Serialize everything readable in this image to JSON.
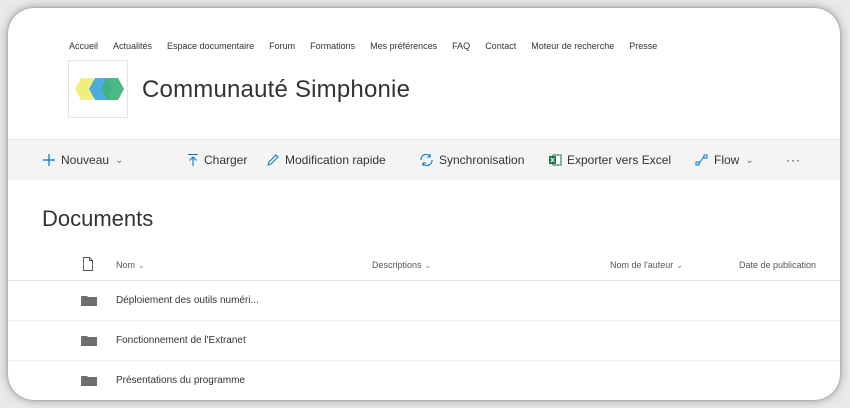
{
  "topnav": {
    "items": [
      "Accueil",
      "Actualités",
      "Espace documentaire",
      "Forum",
      "Formations",
      "Mes préférences",
      "FAQ",
      "Contact",
      "Moteur de recherche",
      "Presse"
    ]
  },
  "site": {
    "title": "Communauté Simphonie"
  },
  "commandbar": {
    "new_label": "Nouveau",
    "upload_label": "Charger",
    "quick_edit_label": "Modification rapide",
    "sync_label": "Synchronisation",
    "export_label": "Exporter vers Excel",
    "flow_label": "Flow",
    "more_label": "···"
  },
  "library": {
    "title": "Documents",
    "columns": {
      "name": "Nom",
      "descriptions": "Descriptions",
      "author": "Nom de l'auteur",
      "published": "Date de publication"
    },
    "rows": [
      {
        "name": "Déploiement des outils numéri..."
      },
      {
        "name": "Fonctionnement de l'Extranet"
      },
      {
        "name": "Présentations du programme"
      }
    ]
  },
  "colors": {
    "accent": "#0078d4",
    "logo_yellow": "#f2ee7e",
    "logo_blue": "#3ba7e0",
    "logo_green": "#3db27a",
    "excel_green": "#1e7145",
    "folder_gray": "#6e6e6e"
  },
  "icons": {
    "new": "plus-icon",
    "upload": "upload-arrow-icon",
    "quick_edit": "pencil-icon",
    "sync": "sync-icon",
    "export": "excel-icon",
    "flow": "flow-icon",
    "file": "file-icon",
    "folder": "folder-icon"
  }
}
